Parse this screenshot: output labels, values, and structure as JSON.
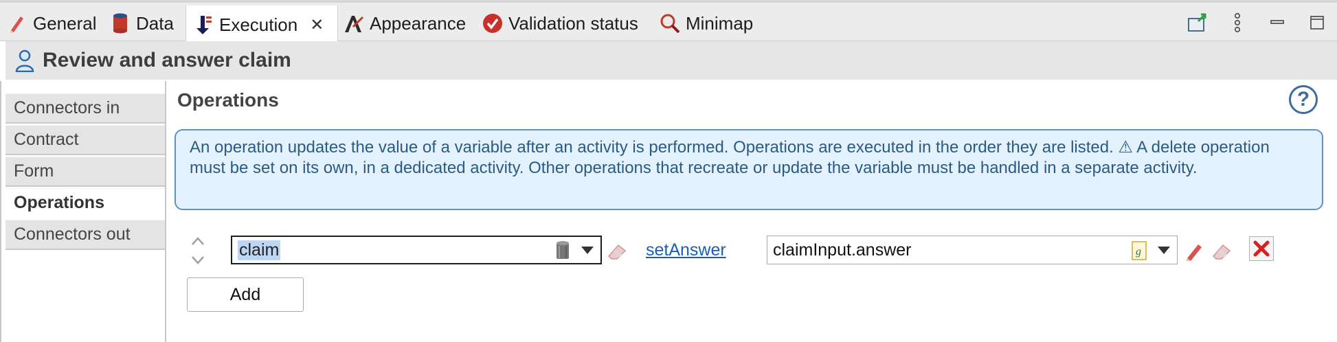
{
  "tabs": [
    {
      "label": "General",
      "icon": "pencil-icon"
    },
    {
      "label": "Data",
      "icon": "database-icon"
    },
    {
      "label": "Execution",
      "icon": "execution-icon",
      "active": true
    },
    {
      "label": "Appearance",
      "icon": "appearance-icon"
    },
    {
      "label": "Validation status",
      "icon": "check-circle-icon"
    },
    {
      "label": "Minimap",
      "icon": "magnifier-icon"
    }
  ],
  "header": {
    "title": "Review and answer claim"
  },
  "nav": {
    "items": [
      "Connectors in",
      "Contract",
      "Form",
      "Operations",
      "Connectors out"
    ],
    "selected": "Operations"
  },
  "main": {
    "section_title": "Operations",
    "help_label": "?",
    "info_text": "An operation updates the value of a variable after an activity is performed. Operations are executed in the order they are listed. ⚠ A delete operation must be set on its own, in a dedicated activity. Other operations that recreate or update the variable must be handled in a separate activity.",
    "operation": {
      "variable": "claim",
      "operator_link": "setAnswer",
      "expression": "claimInput.answer"
    },
    "add_label": "Add"
  },
  "colors": {
    "accent": "#1a5fb4",
    "info_bg": "#e3f2fc",
    "info_border": "#5a93c2",
    "selection": "#bcd6f4",
    "delete_red": "#d62020"
  }
}
